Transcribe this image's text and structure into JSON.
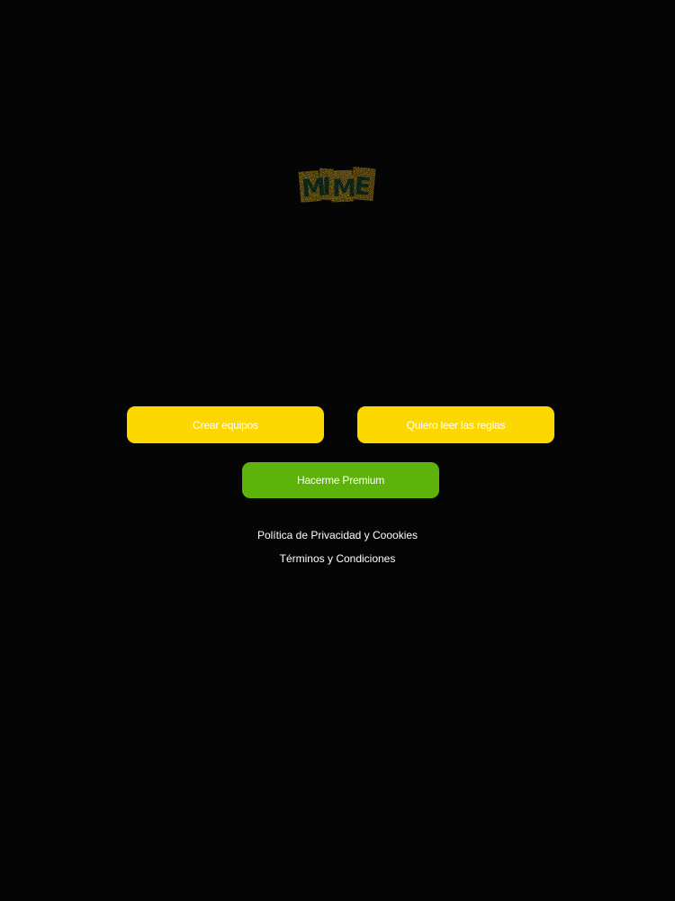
{
  "app": {
    "logo_text": "MIME"
  },
  "buttons": {
    "create_teams": "Crear equipos",
    "read_rules": "Quiero leer las reglas",
    "premium": "Hacerme Premium"
  },
  "links": {
    "privacy": "Política de Privacidad y Coookies",
    "terms": "Términos y Condiciones"
  },
  "colors": {
    "background": "#050505",
    "primary_button": "#fdd800",
    "premium_button": "#5db20c",
    "text": "#ffffff"
  }
}
